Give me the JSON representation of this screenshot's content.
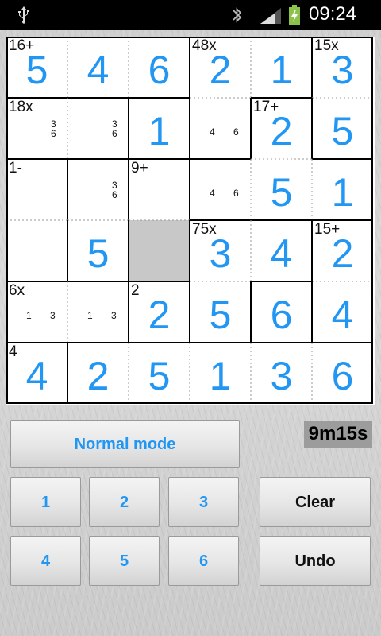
{
  "status_bar": {
    "time": "09:24"
  },
  "board": {
    "size": 6,
    "cages": [
      {
        "label": "16+",
        "row": 0,
        "col": 0
      },
      {
        "label": "48x",
        "row": 0,
        "col": 3
      },
      {
        "label": "15x",
        "row": 0,
        "col": 5
      },
      {
        "label": "18x",
        "row": 1,
        "col": 0
      },
      {
        "label": "17+",
        "row": 1,
        "col": 4
      },
      {
        "label": "1-",
        "row": 2,
        "col": 0
      },
      {
        "label": "9+",
        "row": 2,
        "col": 2
      },
      {
        "label": "75x",
        "row": 3,
        "col": 3
      },
      {
        "label": "15+",
        "row": 3,
        "col": 5
      },
      {
        "label": "6x",
        "row": 4,
        "col": 0
      },
      {
        "label": "2",
        "row": 4,
        "col": 2
      },
      {
        "label": "4",
        "row": 5,
        "col": 0
      }
    ],
    "values": [
      [
        "5",
        "4",
        "6",
        "2",
        "1",
        "3"
      ],
      [
        "",
        "",
        "1",
        "",
        "2",
        "5"
      ],
      [
        "",
        "",
        "",
        "",
        "5",
        "1"
      ],
      [
        "",
        "5",
        "",
        "3",
        "4",
        "2"
      ],
      [
        "",
        "",
        "2",
        "5",
        "6",
        "4"
      ],
      [
        "4",
        "2",
        "5",
        "1",
        "3",
        "6"
      ]
    ],
    "candidates": [
      {
        "row": 1,
        "col": 0,
        "style": "stack",
        "digits": [
          "3",
          "6"
        ]
      },
      {
        "row": 1,
        "col": 1,
        "style": "stack",
        "digits": [
          "3",
          "6"
        ]
      },
      {
        "row": 1,
        "col": 3,
        "style": "row",
        "digits": [
          "4",
          "6"
        ]
      },
      {
        "row": 2,
        "col": 1,
        "style": "stack",
        "digits": [
          "3",
          "6"
        ]
      },
      {
        "row": 2,
        "col": 3,
        "style": "row",
        "digits": [
          "4",
          "6"
        ]
      },
      {
        "row": 4,
        "col": 0,
        "style": "row",
        "digits": [
          "1",
          "3"
        ]
      },
      {
        "row": 4,
        "col": 1,
        "style": "row",
        "digits": [
          "1",
          "3"
        ]
      }
    ],
    "selected_cell": {
      "row": 3,
      "col": 2
    }
  },
  "controls": {
    "mode_button": "Normal mode",
    "timer": "9m15s",
    "digits": [
      "1",
      "2",
      "3",
      "4",
      "5",
      "6"
    ],
    "clear_label": "Clear",
    "undo_label": "Undo"
  },
  "colors": {
    "accent": "#2196f3",
    "selected": "#c8c8c8",
    "timer_bg": "#9c9c9c"
  }
}
